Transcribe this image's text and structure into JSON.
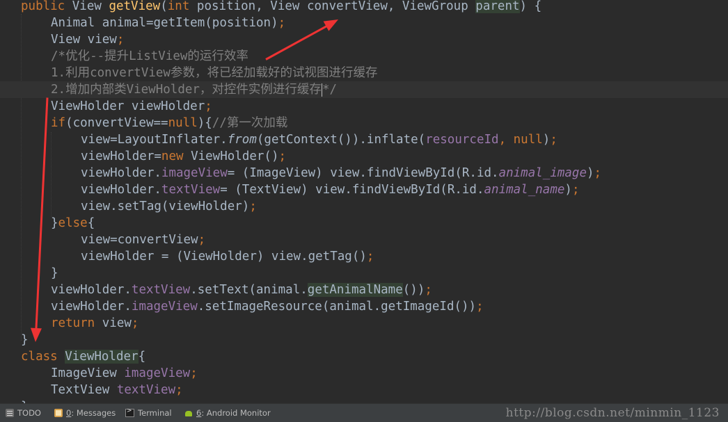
{
  "code_lines": [
    {
      "indent": 0,
      "tokens": [
        [
          "kw",
          "public "
        ],
        [
          "",
          "View "
        ],
        [
          "fn",
          "getView"
        ],
        [
          "",
          "("
        ],
        [
          "kw",
          "int "
        ],
        [
          "",
          "position, View convertView, ViewGroup "
        ],
        [
          "hl",
          "parent"
        ],
        [
          "",
          ") {"
        ]
      ]
    },
    {
      "indent": 1,
      "tokens": [
        [
          "",
          "Animal animal=getItem(position)"
        ],
        [
          "kw",
          ";"
        ]
      ]
    },
    {
      "indent": 1,
      "tokens": [
        [
          "",
          "View view"
        ],
        [
          "kw",
          ";"
        ]
      ]
    },
    {
      "indent": 1,
      "tokens": [
        [
          "cm",
          "/*优化--提升ListView的运行效率"
        ]
      ]
    },
    {
      "indent": 1,
      "tokens": [
        [
          "cm",
          "1.利用convertView参数，将已经加载好的试视图进行缓存"
        ]
      ]
    },
    {
      "indent": 1,
      "tokens": [
        [
          "cm",
          "2.增加内部类ViewHolder，对控件实例进行缓存"
        ],
        [
          "caret",
          ""
        ],
        [
          "cm",
          "*/"
        ]
      ]
    },
    {
      "indent": 1,
      "tokens": [
        [
          "",
          "ViewHolder viewHolder"
        ],
        [
          "kw",
          ";"
        ]
      ]
    },
    {
      "indent": 1,
      "tokens": [
        [
          "kw",
          "if"
        ],
        [
          "",
          "(convertView=="
        ],
        [
          "kw",
          "null"
        ],
        [
          "",
          "){"
        ],
        [
          "cm",
          "//第一次加载"
        ]
      ]
    },
    {
      "indent": 2,
      "tokens": [
        [
          "",
          "view=LayoutInflater."
        ],
        [
          "it",
          "from"
        ],
        [
          "",
          "(getContext()).inflate("
        ],
        [
          "fld",
          "resourceId"
        ],
        [
          "kw",
          ", null"
        ],
        [
          "",
          ")"
        ],
        [
          "kw",
          ";"
        ]
      ]
    },
    {
      "indent": 2,
      "tokens": [
        [
          "",
          "viewHolder="
        ],
        [
          "kw",
          "new "
        ],
        [
          "",
          "ViewHolder()"
        ],
        [
          "kw",
          ";"
        ]
      ]
    },
    {
      "indent": 2,
      "tokens": [
        [
          "",
          "viewHolder."
        ],
        [
          "fld",
          "imageView"
        ],
        [
          "",
          "= (ImageView) view.findViewById(R.id."
        ],
        [
          "sfld",
          "animal_image"
        ],
        [
          "",
          ")"
        ],
        [
          "kw",
          ";"
        ]
      ]
    },
    {
      "indent": 2,
      "tokens": [
        [
          "",
          "viewHolder."
        ],
        [
          "fld",
          "textView"
        ],
        [
          "",
          "= (TextView) view.findViewById(R.id."
        ],
        [
          "sfld",
          "animal_name"
        ],
        [
          "",
          ")"
        ],
        [
          "kw",
          ";"
        ]
      ]
    },
    {
      "indent": 2,
      "tokens": [
        [
          "",
          "view.setTag(viewHolder)"
        ],
        [
          "kw",
          ";"
        ]
      ]
    },
    {
      "indent": 1,
      "tokens": [
        [
          "",
          "}"
        ],
        [
          "kw",
          "else"
        ],
        [
          "",
          "{"
        ]
      ]
    },
    {
      "indent": 2,
      "tokens": [
        [
          "",
          "view=convertView"
        ],
        [
          "kw",
          ";"
        ]
      ]
    },
    {
      "indent": 2,
      "tokens": [
        [
          "",
          "viewHolder = (ViewHolder) view.getTag()"
        ],
        [
          "kw",
          ";"
        ]
      ]
    },
    {
      "indent": 1,
      "tokens": [
        [
          "",
          "}"
        ]
      ]
    },
    {
      "indent": 1,
      "tokens": [
        [
          "",
          "viewHolder."
        ],
        [
          "fld",
          "textView"
        ],
        [
          "",
          ".setText(animal."
        ],
        [
          "hl",
          "getAnimalName"
        ],
        [
          "",
          "())"
        ],
        [
          "kw",
          ";"
        ]
      ]
    },
    {
      "indent": 1,
      "tokens": [
        [
          "",
          "viewHolder."
        ],
        [
          "fld",
          "imageView"
        ],
        [
          "",
          ".setImageResource(animal.getImageId())"
        ],
        [
          "kw",
          ";"
        ]
      ]
    },
    {
      "indent": 1,
      "tokens": [
        [
          "kw",
          "return "
        ],
        [
          "",
          "view"
        ],
        [
          "kw",
          ";"
        ]
      ]
    },
    {
      "indent": 0,
      "tokens": [
        [
          "",
          "}"
        ]
      ]
    },
    {
      "indent": 0,
      "tokens": [
        [
          "kw",
          "class "
        ],
        [
          "hl",
          "ViewHolder"
        ],
        [
          "",
          "{"
        ]
      ]
    },
    {
      "indent": 1,
      "tokens": [
        [
          "",
          "ImageView "
        ],
        [
          "fld",
          "imageView"
        ],
        [
          "kw",
          ";"
        ]
      ]
    },
    {
      "indent": 1,
      "tokens": [
        [
          "",
          "TextView "
        ],
        [
          "fld",
          "textView"
        ],
        [
          "kw",
          ";"
        ]
      ]
    },
    {
      "indent": 0,
      "tokens": [
        [
          "",
          "}"
        ]
      ]
    }
  ],
  "current_line_index": 5,
  "statusbar": {
    "todo": {
      "label": "TODO",
      "icon": "todo-icon"
    },
    "messages": {
      "number": "0",
      "label": ": Messages",
      "icon": "messages-icon"
    },
    "terminal": {
      "label": "Terminal",
      "icon": "terminal-icon"
    },
    "android_monitor": {
      "number": "6",
      "label": ": Android Monitor",
      "icon": "android-icon"
    },
    "watermark": "http://blog.csdn.net/minmin_1123"
  },
  "colors": {
    "background": "#2b2b2b",
    "keyword": "#cc7832",
    "method": "#ffc66d",
    "field": "#9876aa",
    "comment": "#808080",
    "text": "#a9b7c6",
    "annotation_arrow": "#ee3333"
  }
}
